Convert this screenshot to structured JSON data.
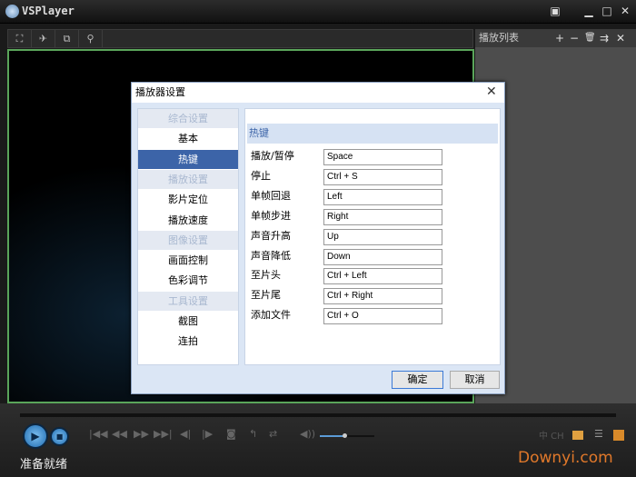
{
  "window": {
    "title": "VSPlayer"
  },
  "toolbar": {
    "icons": [
      "fullscreen-icon",
      "pin-icon",
      "screenshot-window-icon",
      "zoom-icon"
    ]
  },
  "playlist": {
    "title": "播放列表",
    "buttons": [
      "+",
      "−",
      "🗑",
      "⇉",
      "✕"
    ]
  },
  "dialog": {
    "title": "播放器设置",
    "nav": [
      {
        "label": "综合设置",
        "type": "group"
      },
      {
        "label": "基本",
        "type": "item"
      },
      {
        "label": "热键",
        "type": "selected"
      },
      {
        "label": "播放设置",
        "type": "group"
      },
      {
        "label": "影片定位",
        "type": "item"
      },
      {
        "label": "播放速度",
        "type": "item"
      },
      {
        "label": "图像设置",
        "type": "group"
      },
      {
        "label": "画面控制",
        "type": "item"
      },
      {
        "label": "色彩调节",
        "type": "item"
      },
      {
        "label": "工具设置",
        "type": "group"
      },
      {
        "label": "截图",
        "type": "item"
      },
      {
        "label": "连拍",
        "type": "item"
      }
    ],
    "section_title": "热键",
    "hotkeys": [
      {
        "label": "播放/暂停",
        "value": "Space"
      },
      {
        "label": "停止",
        "value": "Ctrl + S"
      },
      {
        "label": "单帧回退",
        "value": "Left"
      },
      {
        "label": "单帧步进",
        "value": "Right"
      },
      {
        "label": "声音升高",
        "value": "Up"
      },
      {
        "label": "声音降低",
        "value": "Down"
      },
      {
        "label": "至片头",
        "value": "Ctrl + Left"
      },
      {
        "label": "至片尾",
        "value": "Ctrl + Right"
      },
      {
        "label": "添加文件",
        "value": "Ctrl + O"
      }
    ],
    "ok_label": "确定",
    "cancel_label": "取消"
  },
  "controls": {
    "volume": 0.45,
    "lang": "中 CH"
  },
  "status": "准备就绪",
  "watermark": "Downyi.com"
}
